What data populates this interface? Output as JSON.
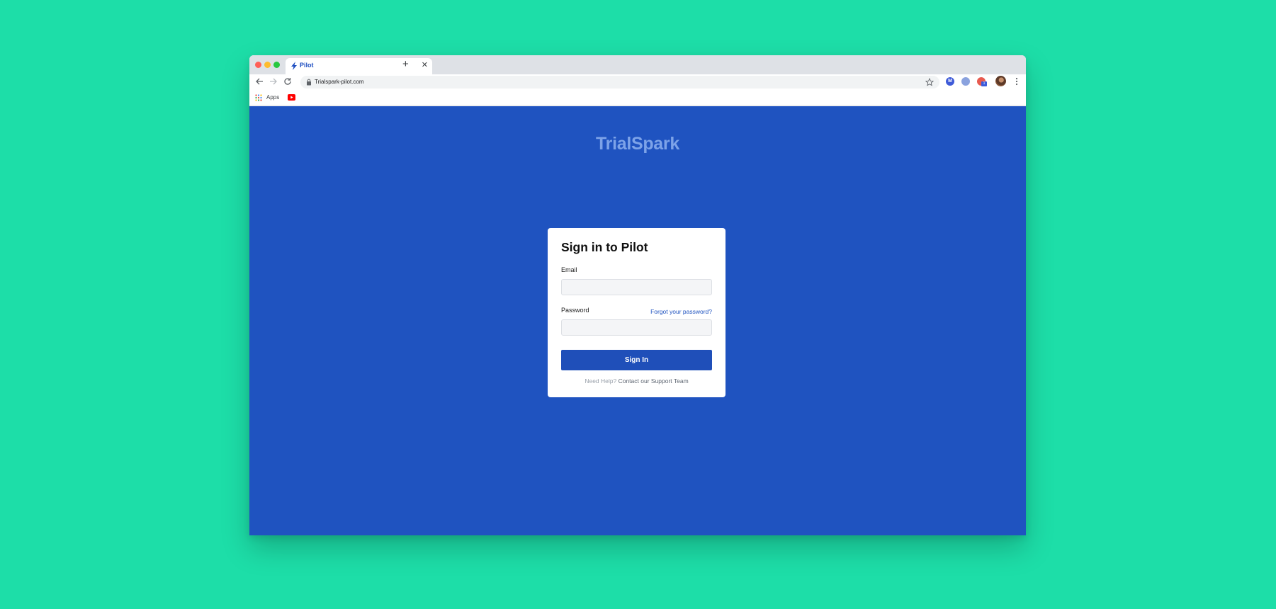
{
  "browser": {
    "tab": {
      "title": "Pilot",
      "close_glyph": "✕"
    },
    "new_tab_glyph": "+",
    "omnibox": {
      "url": "Trialspark-pilot.com"
    },
    "extensions": [
      {
        "name": "extension-m",
        "color": "#3f5bd8",
        "label": "M"
      },
      {
        "name": "extension-grammar",
        "color": "#5f7fd6",
        "label": ""
      },
      {
        "name": "extension-badge",
        "color": "#e85a4f",
        "badge": "1"
      }
    ],
    "bookmarks": {
      "apps_label": "Apps"
    }
  },
  "page": {
    "logo": "TrialSpark",
    "form": {
      "title": "Sign in to Pilot",
      "email_label": "Email",
      "email_value": "",
      "password_label": "Password",
      "password_value": "",
      "forgot_link": "Forgot your password?",
      "submit_label": "Sign In",
      "help_question": "Need Help?",
      "help_link": "Contact our Support Team"
    }
  },
  "colors": {
    "background": "#1ddea8",
    "page_background": "#1f53c0",
    "button": "#1f4fb9",
    "logo": "#7da3e8"
  }
}
